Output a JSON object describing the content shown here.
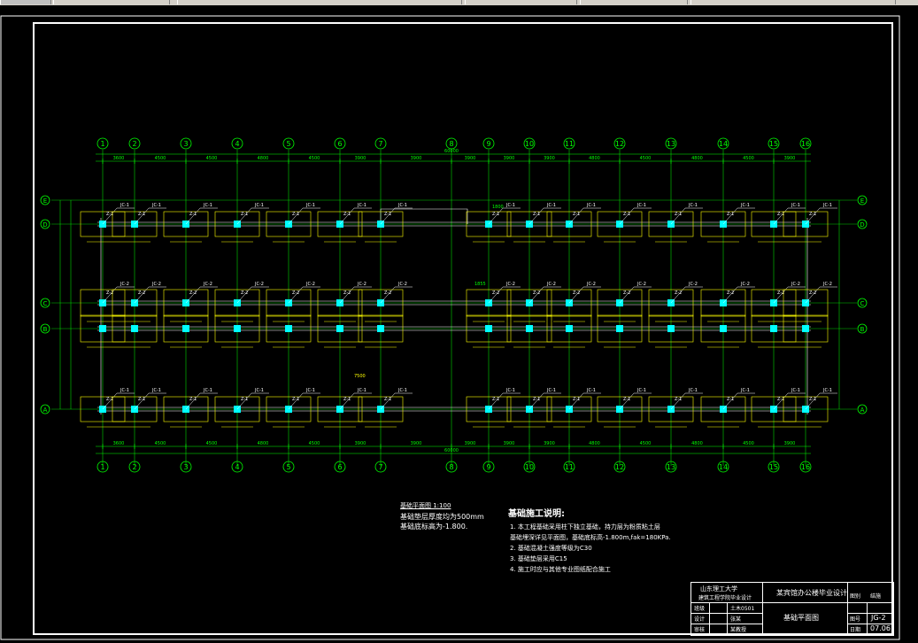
{
  "drawing": {
    "axes_columns": [
      "1",
      "2",
      "3",
      "4",
      "5",
      "6",
      "7",
      "8",
      "9",
      "10",
      "11",
      "12",
      "13",
      "14",
      "15",
      "16"
    ],
    "axes_rows": [
      "E",
      "D",
      "C",
      "B",
      "A"
    ],
    "top_dimensions": [
      "3600",
      "4500",
      "4500",
      "4800",
      "4500",
      "3900",
      "3900",
      "3900",
      "3900",
      "3900",
      "4800",
      "4500",
      "4800",
      "4500",
      "3900"
    ],
    "bottom_dimensions": [
      "3600",
      "4500",
      "4500",
      "4800",
      "4500",
      "3900",
      "3900",
      "3900",
      "3900",
      "3900",
      "4800",
      "4500",
      "4800",
      "4500",
      "3900"
    ],
    "overall_top": "60000",
    "overall_bottom": "60000",
    "labels": {
      "jc1": "JC-1",
      "jc2": "JC-2",
      "z1": "Z-1",
      "z2": "Z-2",
      "dim_7500": "7500",
      "dim_1800": "1800",
      "dim_1855": "1855"
    },
    "colors": {
      "axis": "#00ff00",
      "beam": "#ffffff",
      "footing": "#ffff00",
      "column": "#00ffff",
      "leader": "#ffffff",
      "dim": "#00ff00"
    }
  },
  "legend": {
    "title": "基础平面图 1:100",
    "line1": "基础垫层厚度均为500mm",
    "line2": "基础底标高为-1.800."
  },
  "notes": {
    "title": "基础施工说明:",
    "items": [
      "1. 本工程基础采用柱下独立基础，持力层为粉质粘土层",
      "   基础埋深详见平面图，基础底标高-1.800m,fak=180KPa.",
      "2. 基础混凝土强度等级为C30",
      "3. 基础垫层采用C15",
      "4. 施工时应与其他专业图纸配合施工"
    ]
  },
  "title_block": {
    "school": "山东理工大学",
    "dept": "建筑工程学院毕业设计",
    "project": "某宾馆办公楼毕业设计",
    "drawing_name": "基础平面图",
    "r1c1": "班级",
    "r1c2": "土木0501",
    "r2c1": "设计",
    "r2c2": "张某",
    "r3c1": "审核",
    "r3c2": "某教授",
    "sheet_label": "图别",
    "sheet_value": "结施",
    "no_label": "图号",
    "no_value": "JG-2",
    "date_label": "日期",
    "date_value": "07.06"
  }
}
